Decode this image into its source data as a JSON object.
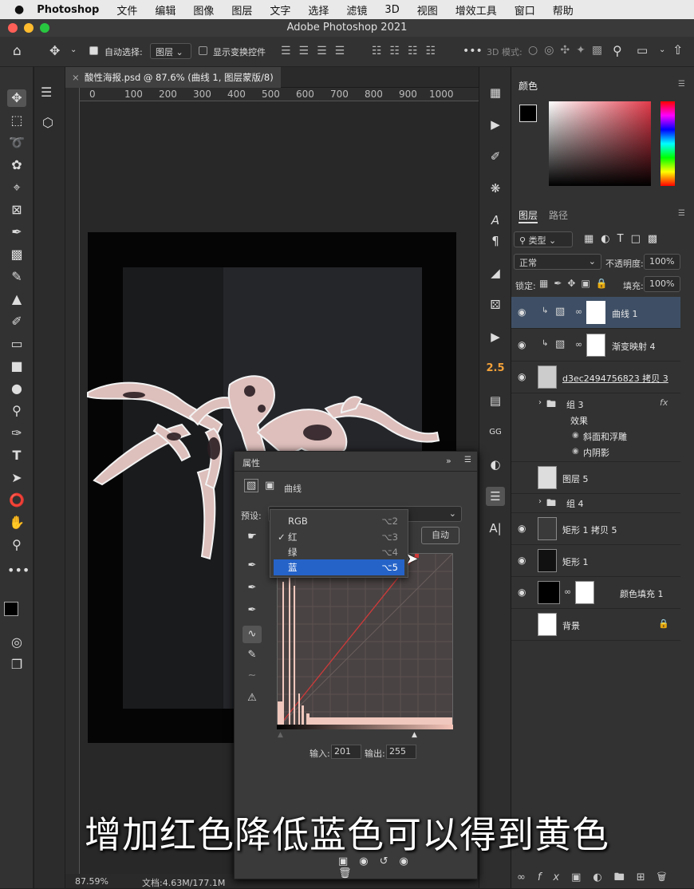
{
  "menubar": {
    "apple": "",
    "app": "Photoshop",
    "items": [
      "文件",
      "编辑",
      "图像",
      "图层",
      "文字",
      "选择",
      "滤镜",
      "3D",
      "视图",
      "增效工具",
      "窗口",
      "帮助"
    ]
  },
  "window": {
    "title": "Adobe Photoshop 2021"
  },
  "options": {
    "auto_select_label": "自动选择:",
    "auto_select_value": "图层",
    "show_transform_label": "显示变换控件",
    "mode_3d_label": "3D 模式:"
  },
  "document": {
    "tab_title": "酸性海报.psd @ 87.6% (曲线 1, 图层蒙版/8) *",
    "zoom": "87.59%",
    "doc_size": "文档:4.63M/177.1M",
    "ruler_top": [
      "0",
      "100",
      "200",
      "300",
      "400",
      "500",
      "600",
      "700",
      "800",
      "900",
      "1000"
    ]
  },
  "color_panel": {
    "title": "颜色",
    "fg": "#000000",
    "bg": "#ffffff"
  },
  "layers_panel": {
    "tabs": [
      "图层",
      "路径"
    ],
    "filter_label": "类型",
    "blend_mode": "正常",
    "opacity_label": "不透明度:",
    "opacity_value": "100%",
    "lock_label": "锁定:",
    "fill_label": "填充:",
    "fill_value": "100%",
    "layers": [
      {
        "name": "曲线 1",
        "visible": true,
        "selected": true
      },
      {
        "name": "渐变映射 4",
        "visible": true
      },
      {
        "name": "d3ec2494756823 拷贝 3",
        "visible": true
      },
      {
        "name": "组 3",
        "visible": false
      },
      {
        "name": "效果",
        "visible": false
      },
      {
        "name": "斜面和浮雕",
        "visible": false
      },
      {
        "name": "内阴影",
        "visible": false
      },
      {
        "name": "图层 5",
        "visible": false
      },
      {
        "name": "组 4",
        "visible": false
      },
      {
        "name": "矩形 1 拷贝 5",
        "visible": true
      },
      {
        "name": "矩形 1",
        "visible": true
      },
      {
        "name": "颜色填充 1",
        "visible": true
      },
      {
        "name": "背景",
        "visible": false
      }
    ],
    "fx_label": "fx"
  },
  "properties": {
    "title": "属性",
    "type_label": "曲线",
    "preset_label": "预设:",
    "auto_button": "自动",
    "channels": [
      {
        "label": "RGB",
        "shortcut": "⌥2",
        "checked": false,
        "highlighted": false
      },
      {
        "label": "红",
        "shortcut": "⌥3",
        "checked": true,
        "highlighted": false
      },
      {
        "label": "绿",
        "shortcut": "⌥4",
        "checked": false,
        "highlighted": false
      },
      {
        "label": "蓝",
        "shortcut": "⌥5",
        "checked": false,
        "highlighted": true
      }
    ],
    "input_label": "输入:",
    "input_value": "201",
    "output_label": "输出:",
    "output_value": "255"
  },
  "rightstrip": {
    "value_label": "2.5"
  },
  "subtitle": "增加红色降低蓝色可以得到黄色"
}
